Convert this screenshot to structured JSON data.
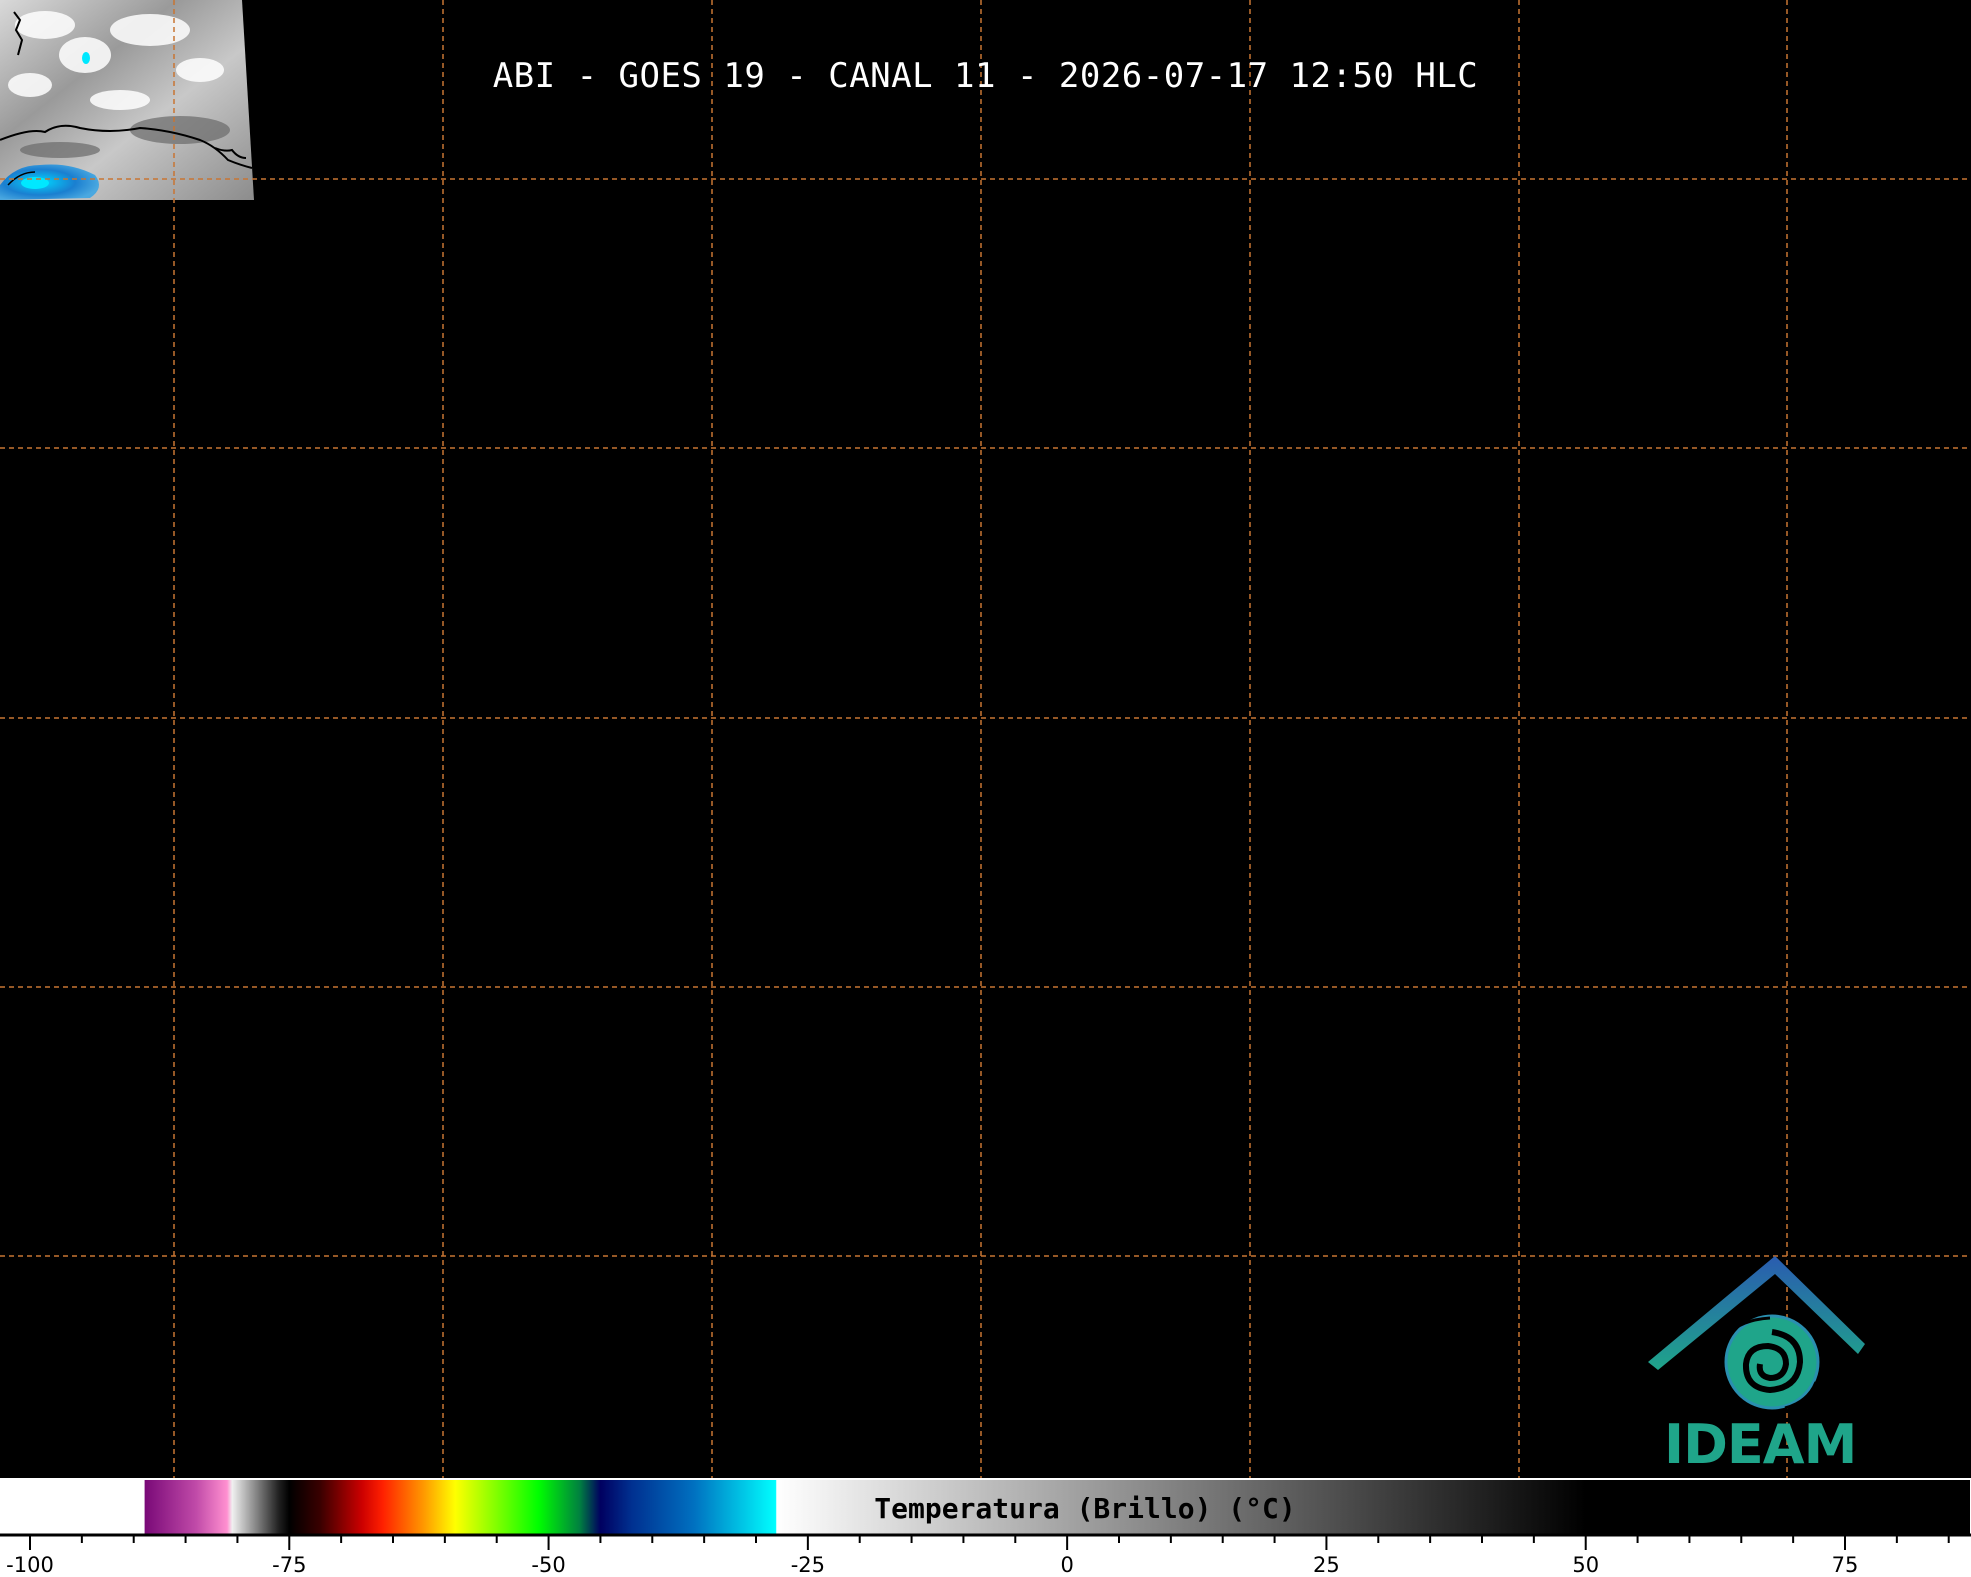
{
  "title": "ABI - GOES 19 - CANAL 11 - 2026-07-17 12:50 HLC",
  "colors": {
    "background": "#000000",
    "grid": "#c87533",
    "coastline": "#000000",
    "logo_blue": "#2a6db0",
    "logo_green": "#1fa58a"
  },
  "logo": {
    "name": "ideam-logo",
    "text": "IDEAM"
  },
  "colorbar": {
    "label": "Temperatura (Brillo) (°C)",
    "range": [
      -100,
      85
    ],
    "major_ticks": [
      -100,
      -75,
      -50,
      -25,
      0,
      25,
      50,
      75
    ],
    "major_labels": [
      "-100",
      "-75",
      "-50",
      "-25",
      "0",
      "25",
      "50",
      "75"
    ],
    "minor_step": 5,
    "stops": [
      {
        "v": -100,
        "c": "#ffffff"
      },
      {
        "v": -89,
        "c": "#ffffff"
      },
      {
        "v": -88.9,
        "c": "#7a0a78"
      },
      {
        "v": -84,
        "c": "#c04aa8"
      },
      {
        "v": -81,
        "c": "#ff90d0"
      },
      {
        "v": -80.5,
        "c": "#f0f0f0"
      },
      {
        "v": -76,
        "c": "#202020"
      },
      {
        "v": -75,
        "c": "#000000"
      },
      {
        "v": -72,
        "c": "#3a0000"
      },
      {
        "v": -68,
        "c": "#cc0000"
      },
      {
        "v": -66,
        "c": "#ff2000"
      },
      {
        "v": -62,
        "c": "#ff9a00"
      },
      {
        "v": -59,
        "c": "#ffff00"
      },
      {
        "v": -55,
        "c": "#80ff00"
      },
      {
        "v": -51,
        "c": "#00ff00"
      },
      {
        "v": -47,
        "c": "#008040"
      },
      {
        "v": -45,
        "c": "#000060"
      },
      {
        "v": -42,
        "c": "#003090"
      },
      {
        "v": -36,
        "c": "#0070c0"
      },
      {
        "v": -28.1,
        "c": "#00ffff"
      },
      {
        "v": -28,
        "c": "#ffffff"
      },
      {
        "v": 50,
        "c": "#000000"
      },
      {
        "v": 85,
        "c": "#000000"
      }
    ]
  }
}
